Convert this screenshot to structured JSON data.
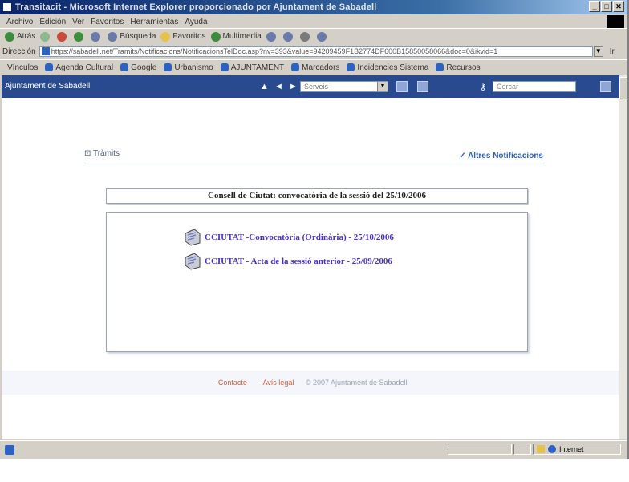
{
  "window": {
    "title": "Transitacit - Microsoft Internet Explorer proporcionado por Ajuntament de Sabadell",
    "controls": [
      "_",
      "□",
      "✕"
    ]
  },
  "menu": [
    "Archivo",
    "Edición",
    "Ver",
    "Favoritos",
    "Herramientas",
    "Ayuda"
  ],
  "toolbar": {
    "back": "Atrás",
    "search": "Búsqueda",
    "favorites": "Favoritos",
    "multimedia": "Multimedia"
  },
  "address": {
    "label": "Dirección",
    "url": "https://sabadell.net/Tramits/Notificacions/NotificacionsTelDoc.asp?nv=393&value=94209459F1B2774DF600B15850058066&doc=0&ikvid=1",
    "go": "Ir"
  },
  "links": [
    "Vínculos",
    "Agenda Cultural",
    "Google",
    "Urbanismo",
    "AJUNTAMENT",
    "Marcadors",
    "Incidencies Sistema",
    "Recursos"
  ],
  "site": {
    "brand": "Ajuntament de Sabadell",
    "section_select": "Serveis",
    "search_placeholder": "Cercar"
  },
  "page": {
    "section_title": "Tràmits",
    "other_notifications": "Altres Notificacions",
    "panel_title": "Consell de Ciutat: convocatòria de la sessió del 25/10/2006",
    "documents": [
      "CCIUTAT -Convocatòria (Ordinària) - 25/10/2006",
      "CCIUTAT - Acta de la sessió anterior - 25/09/2006"
    ]
  },
  "footer": {
    "contact": "· Contacte",
    "legal": "· Avís legal",
    "copyright": "© 2007 Ajuntament de Sabadell"
  },
  "status": {
    "zone": "Internet"
  },
  "colors": {
    "site_bar": "#2a4a8f",
    "link": "#4b2fc7",
    "footer_link": "#d05c3c"
  }
}
